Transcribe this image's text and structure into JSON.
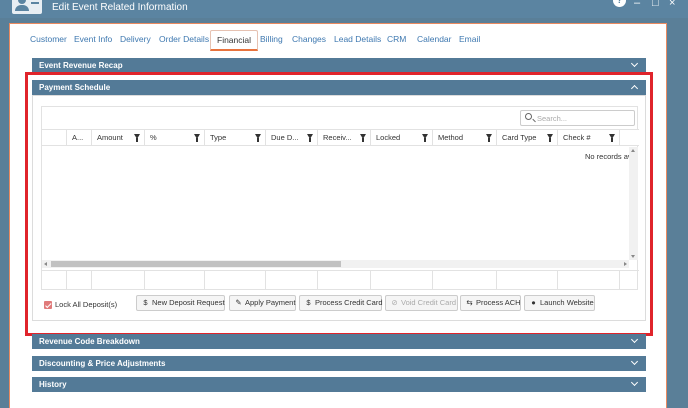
{
  "window": {
    "title": "Edit Event Related Information",
    "help": "?",
    "minimize": "–",
    "maximize": "□",
    "close": "×"
  },
  "tabs": [
    "Customer",
    "Event Info",
    "Delivery",
    "Order Details",
    "Financial",
    "Billing",
    "Changes",
    "Lead Details",
    "CRM",
    "Calendar",
    "Email"
  ],
  "active_tab": "Financial",
  "sections": {
    "event_revenue_recap": "Event Revenue Recap",
    "payment_schedule": "Payment Schedule",
    "revenue_code_breakdown": "Revenue Code Breakdown",
    "discounting": "Discounting & Price Adjustments",
    "history": "History"
  },
  "grid": {
    "search_placeholder": "Search...",
    "columns": [
      "",
      "A...",
      "Amount",
      "%",
      "Type",
      "Due D...",
      "Receiv...",
      "Locked",
      "Method",
      "Card Type",
      "Check #"
    ],
    "no_records": "No records av"
  },
  "actions": {
    "lock_all": "Lock All Deposit(s)",
    "buttons": [
      {
        "label": "New Deposit Request",
        "icon": "dollar-icon",
        "glyph": "$",
        "enabled": true
      },
      {
        "label": "Apply Payment",
        "icon": "edit-icon",
        "glyph": "✎",
        "enabled": true
      },
      {
        "label": "Process Credit Card",
        "icon": "dollar-icon",
        "glyph": "$",
        "enabled": true
      },
      {
        "label": "Void Credit Card",
        "icon": "ban-icon",
        "glyph": "⊘",
        "enabled": false
      },
      {
        "label": "Process ACH",
        "icon": "exchange-icon",
        "glyph": "⇆",
        "enabled": true
      },
      {
        "label": "Launch Website",
        "icon": "globe-icon",
        "glyph": "●",
        "enabled": true
      }
    ]
  },
  "colors": {
    "section_header": "#537a97",
    "titlebar": "#5b84a1",
    "highlight": "#e0242b",
    "tab_active_underline": "#e8733d",
    "link": "#3e78b0"
  }
}
